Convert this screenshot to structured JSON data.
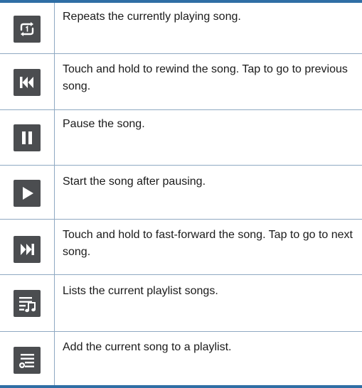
{
  "rows": [
    {
      "icon": "repeat-one-icon",
      "text": "Repeats the currently playing song."
    },
    {
      "icon": "previous-track-icon",
      "text": "Touch and hold to rewind the song. Tap to go to previous song."
    },
    {
      "icon": "pause-icon",
      "text": "Pause the song."
    },
    {
      "icon": "play-icon",
      "text": "Start the song after pausing."
    },
    {
      "icon": "next-track-icon",
      "text": "Touch and hold to fast-forward the song. Tap to go to next song."
    },
    {
      "icon": "playlist-icon",
      "text": "Lists the current playlist songs."
    },
    {
      "icon": "add-to-playlist-icon",
      "text": "Add the current song to a playlist."
    }
  ],
  "colors": {
    "rule": "#2f6ea5",
    "grid": "#8fa9c2",
    "icon_bg": "#4b4d50",
    "icon_fg": "#ffffff"
  }
}
